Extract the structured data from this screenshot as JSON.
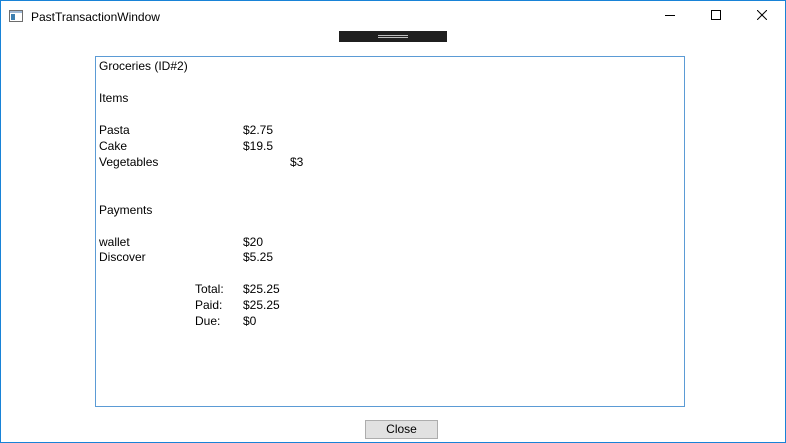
{
  "window": {
    "title": "PastTransactionWindow"
  },
  "receipt": {
    "heading": "Groceries (ID#2)",
    "items_label": "Items",
    "items": [
      {
        "name": "Pasta",
        "price": "$2.75"
      },
      {
        "name": "Cake",
        "price": "$19.5"
      },
      {
        "name": "Vegetables",
        "price": "$3"
      }
    ],
    "payments_label": "Payments",
    "payments": [
      {
        "method": "wallet",
        "amount": "$20"
      },
      {
        "method": "Discover",
        "amount": "$5.25"
      }
    ],
    "totals": [
      {
        "label": "Total:",
        "value": "$25.25"
      },
      {
        "label": "Paid:",
        "value": "$25.25"
      },
      {
        "label": "Due:",
        "value": "$0"
      }
    ]
  },
  "footer": {
    "close_label": "Close"
  },
  "colors": {
    "window_border": "#1883d7",
    "receipt_border": "#5b9bd5",
    "button_face": "#e1e1e1",
    "toolbar_grip": "#1f1f1f"
  },
  "icons": {
    "app": "app-window-icon",
    "minimize": "minimize-icon",
    "maximize": "maximize-icon",
    "close": "close-icon"
  }
}
